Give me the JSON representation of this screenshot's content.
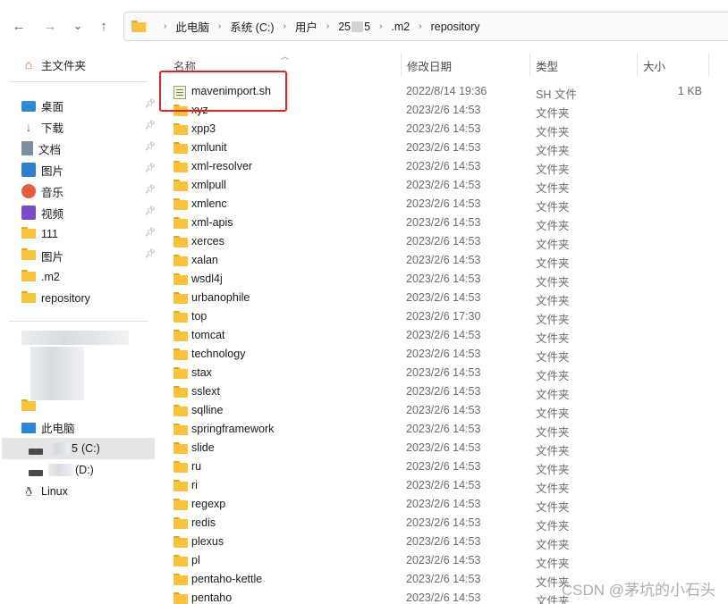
{
  "nav": {
    "back": "←",
    "forward": "→",
    "recent": "⌄",
    "up": "↑"
  },
  "address": {
    "crumbs": [
      "此电脑",
      "系统 (C:)",
      "用户",
      "25",
      "5",
      ".m2",
      "repository"
    ]
  },
  "sidebar": {
    "home": "主文件夹",
    "quick": [
      {
        "label": "桌面",
        "icon": "desktop-icon"
      },
      {
        "label": "下载",
        "icon": "download-icon"
      },
      {
        "label": "文档",
        "icon": "documents-icon"
      },
      {
        "label": "图片",
        "icon": "pictures-icon"
      },
      {
        "label": "音乐",
        "icon": "music-icon"
      },
      {
        "label": "视频",
        "icon": "videos-icon"
      },
      {
        "label": "111",
        "icon": "folder-icon"
      },
      {
        "label": "图片",
        "icon": "folder-icon"
      },
      {
        "label": ".m2",
        "icon": "folder-icon"
      },
      {
        "label": "repository",
        "icon": "folder-icon"
      }
    ],
    "this_pc": "此电脑",
    "drive_c": "(C:)",
    "drive_c_prefix": "5",
    "drive_d": "(D:)",
    "linux": "Linux"
  },
  "columns": {
    "name": "名称",
    "date": "修改日期",
    "type": "类型",
    "size": "大小"
  },
  "files": [
    {
      "name": "mavenimport.sh",
      "date": "2022/8/14 19:36",
      "type": "SH 文件",
      "size": "1 KB",
      "icon": "shell-script-icon"
    },
    {
      "name": "xyz",
      "date": "2023/2/6 14:53",
      "type": "文件夹",
      "size": "",
      "icon": "folder-icon"
    },
    {
      "name": "xpp3",
      "date": "2023/2/6 14:53",
      "type": "文件夹",
      "size": "",
      "icon": "folder-icon"
    },
    {
      "name": "xmlunit",
      "date": "2023/2/6 14:53",
      "type": "文件夹",
      "size": "",
      "icon": "folder-icon"
    },
    {
      "name": "xml-resolver",
      "date": "2023/2/6 14:53",
      "type": "文件夹",
      "size": "",
      "icon": "folder-icon"
    },
    {
      "name": "xmlpull",
      "date": "2023/2/6 14:53",
      "type": "文件夹",
      "size": "",
      "icon": "folder-icon"
    },
    {
      "name": "xmlenc",
      "date": "2023/2/6 14:53",
      "type": "文件夹",
      "size": "",
      "icon": "folder-icon"
    },
    {
      "name": "xml-apis",
      "date": "2023/2/6 14:53",
      "type": "文件夹",
      "size": "",
      "icon": "folder-icon"
    },
    {
      "name": "xerces",
      "date": "2023/2/6 14:53",
      "type": "文件夹",
      "size": "",
      "icon": "folder-icon"
    },
    {
      "name": "xalan",
      "date": "2023/2/6 14:53",
      "type": "文件夹",
      "size": "",
      "icon": "folder-icon"
    },
    {
      "name": "wsdl4j",
      "date": "2023/2/6 14:53",
      "type": "文件夹",
      "size": "",
      "icon": "folder-icon"
    },
    {
      "name": "urbanophile",
      "date": "2023/2/6 14:53",
      "type": "文件夹",
      "size": "",
      "icon": "folder-icon"
    },
    {
      "name": "top",
      "date": "2023/2/6 17:30",
      "type": "文件夹",
      "size": "",
      "icon": "folder-icon"
    },
    {
      "name": "tomcat",
      "date": "2023/2/6 14:53",
      "type": "文件夹",
      "size": "",
      "icon": "folder-icon"
    },
    {
      "name": "technology",
      "date": "2023/2/6 14:53",
      "type": "文件夹",
      "size": "",
      "icon": "folder-icon"
    },
    {
      "name": "stax",
      "date": "2023/2/6 14:53",
      "type": "文件夹",
      "size": "",
      "icon": "folder-icon"
    },
    {
      "name": "sslext",
      "date": "2023/2/6 14:53",
      "type": "文件夹",
      "size": "",
      "icon": "folder-icon"
    },
    {
      "name": "sqlline",
      "date": "2023/2/6 14:53",
      "type": "文件夹",
      "size": "",
      "icon": "folder-icon"
    },
    {
      "name": "springframework",
      "date": "2023/2/6 14:53",
      "type": "文件夹",
      "size": "",
      "icon": "folder-icon"
    },
    {
      "name": "slide",
      "date": "2023/2/6 14:53",
      "type": "文件夹",
      "size": "",
      "icon": "folder-icon"
    },
    {
      "name": "ru",
      "date": "2023/2/6 14:53",
      "type": "文件夹",
      "size": "",
      "icon": "folder-icon"
    },
    {
      "name": "ri",
      "date": "2023/2/6 14:53",
      "type": "文件夹",
      "size": "",
      "icon": "folder-icon"
    },
    {
      "name": "regexp",
      "date": "2023/2/6 14:53",
      "type": "文件夹",
      "size": "",
      "icon": "folder-icon"
    },
    {
      "name": "redis",
      "date": "2023/2/6 14:53",
      "type": "文件夹",
      "size": "",
      "icon": "folder-icon"
    },
    {
      "name": "plexus",
      "date": "2023/2/6 14:53",
      "type": "文件夹",
      "size": "",
      "icon": "folder-icon"
    },
    {
      "name": "pl",
      "date": "2023/2/6 14:53",
      "type": "文件夹",
      "size": "",
      "icon": "folder-icon"
    },
    {
      "name": "pentaho-kettle",
      "date": "2023/2/6 14:53",
      "type": "文件夹",
      "size": "",
      "icon": "folder-icon"
    },
    {
      "name": "pentaho",
      "date": "2023/2/6 14:53",
      "type": "文件夹",
      "size": "",
      "icon": "folder-icon"
    }
  ],
  "watermark": "CSDN @茅坑的小石头",
  "colors": {
    "highlight_border": "#e8231f",
    "folder": "#f8c33a",
    "selection": "#e5e5e5"
  }
}
